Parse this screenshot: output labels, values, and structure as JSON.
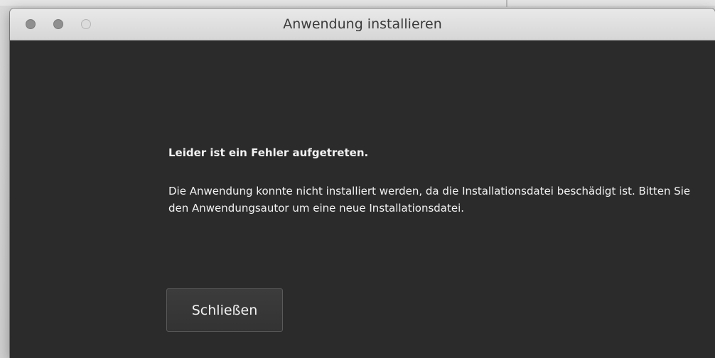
{
  "window": {
    "title": "Anwendung installieren"
  },
  "dialog": {
    "heading": "Leider ist ein Fehler aufgetreten.",
    "message": "Die Anwendung konnte nicht installiert werden, da die Installationsdatei beschädigt ist. Bitten Sie den Anwendungsautor um eine neue Installationsdatei.",
    "close_label": "Schließen"
  },
  "colors": {
    "content_background": "#2b2b2b",
    "titlebar_background": "#e2e2e2",
    "text": "#f2f2f2"
  }
}
